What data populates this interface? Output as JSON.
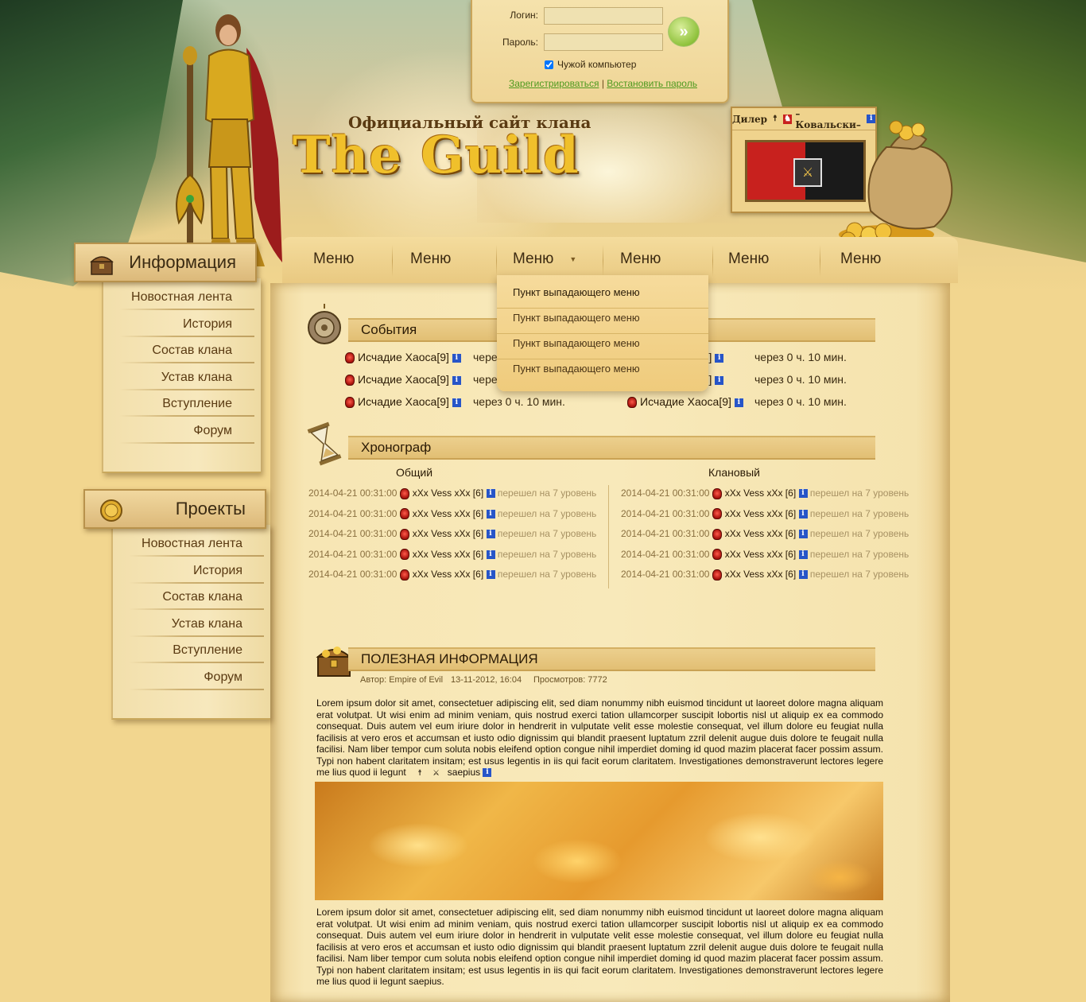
{
  "login": {
    "login_label": "Логин:",
    "password_label": "Пароль:",
    "login_value": "",
    "password_value": "",
    "remember_label": "Чужой компьютер",
    "register_link": "Зарегистрироваться",
    "restore_link": "Востановить пароль",
    "separator": "|",
    "submit_glyph": "»"
  },
  "header": {
    "subtitle": "Официальный сайт клана",
    "title": "The Guild"
  },
  "dealer": {
    "label": "Дилер",
    "name": "–Ковальски–"
  },
  "menu": {
    "items": [
      "Меню",
      "Меню",
      "Меню",
      "Меню",
      "Меню",
      "Меню"
    ],
    "dropdown": [
      "Пункт выпадающего меню",
      "Пункт выпадающего меню",
      "Пункт выпадающего меню",
      "Пункт выпадающего меню"
    ]
  },
  "sidebar": {
    "info_title": "Информация",
    "info_links": [
      "Новостная лента",
      "История",
      "Состав клана",
      "Устав клана",
      "Вступление",
      "Форум"
    ],
    "projects_title": "Проекты",
    "projects_links": [
      "Новостная лента",
      "История",
      "Состав клана",
      "Устав клана",
      "Вступление",
      "Форум"
    ]
  },
  "events": {
    "title": "События",
    "rows": [
      {
        "name": "Исчадие Хаоса[9]",
        "time": "через 0 ч. 10 мин."
      },
      {
        "name": "Исчадие Хаоса[9]",
        "time": "через 0 ч. 10 мин."
      },
      {
        "name": "Исчадие Хаоса[9]",
        "time": "через 0 ч. 10 мин."
      },
      {
        "name": "Исчадие Хаоса[9]",
        "time": "через 0 ч. 10 мин."
      },
      {
        "name": "Исчадие Хаоса[9]",
        "time": "через 0 ч. 10 мин."
      },
      {
        "name": "Исчадие Хаоса[9]",
        "time": "через 0 ч. 10 мин."
      }
    ],
    "partial_left": "чере",
    "partial_right": "а[9]"
  },
  "chrono": {
    "title": "Хронограф",
    "col_general": "Общий",
    "col_clan": "Клановый",
    "rows": [
      {
        "date": "2014-04-21 00:31:00",
        "who": "xXx Vess xXx [6]",
        "what": "перешел на 7 уровень"
      },
      {
        "date": "2014-04-21 00:31:00",
        "who": "xXx Vess xXx [6]",
        "what": "перешел на 7 уровень"
      },
      {
        "date": "2014-04-21 00:31:00",
        "who": "xXx Vess xXx [6]",
        "what": "перешел на 7 уровень"
      },
      {
        "date": "2014-04-21 00:31:00",
        "who": "xXx Vess xXx [6]",
        "what": "перешел на 7 уровень"
      },
      {
        "date": "2014-04-21 00:31:00",
        "who": "xXx Vess xXx [6]",
        "what": "перешел на 7 уровень"
      }
    ]
  },
  "article": {
    "title": "ПОЛЕЗНАЯ ИНФОРМАЦИЯ",
    "author": "Автор: Empire of Evil",
    "date": "13-11-2012, 16:04",
    "views": "Просмотров: 7772",
    "para1": "Lorem ipsum dolor sit amet, consectetuer adipiscing elit, sed diam nonummy nibh euismod tincidunt ut laoreet dolore magna aliquam erat volutpat. Ut wisi enim ad minim veniam, quis nostrud exerci tation ullamcorper suscipit lobortis nisl ut aliquip ex ea commodo consequat. Duis autem vel eum iriure dolor in hendrerit in vulputate velit esse molestie consequat, vel illum dolore eu feugiat nulla facilisis at vero eros et accumsan et iusto odio dignissim qui blandit praesent luptatum zzril delenit augue duis dolore te feugait nulla facilisi. Nam liber tempor cum soluta nobis eleifend option congue nihil imperdiet doming id quod mazim placerat facer possim assum. Typi non habent claritatem insitam; est usus legentis in iis qui facit eorum claritatem. Investigationes demonstraverunt lectores legere me lius quod ii legunt",
    "player": "saepius",
    "para2": "Lorem ipsum dolor sit amet, consectetuer adipiscing elit, sed diam nonummy nibh euismod tincidunt ut laoreet dolore magna aliquam erat volutpat. Ut wisi enim ad minim veniam, quis nostrud exerci tation ullamcorper suscipit lobortis nisl ut aliquip ex ea commodo consequat. Duis autem vel eum iriure dolor in hendrerit in vulputate velit esse molestie consequat, vel illum dolore eu feugiat nulla facilisis at vero eros et accumsan et iusto odio dignissim qui blandit praesent luptatum zzril delenit augue duis dolore te feugait nulla facilisi. Nam liber tempor cum soluta nobis eleifend option congue nihil imperdiet doming id quod mazim placerat facer possim assum. Typi non habent claritatem insitam; est usus legentis in iis qui facit eorum claritatem. Investigationes demonstraverunt lectores legere me lius quod ii legunt saepius."
  },
  "colors": {
    "parchment": "#f8e9ba",
    "accent_gold": "#f0c02b",
    "link_green": "#4f9a1f",
    "info_blue": "#2755c8"
  }
}
